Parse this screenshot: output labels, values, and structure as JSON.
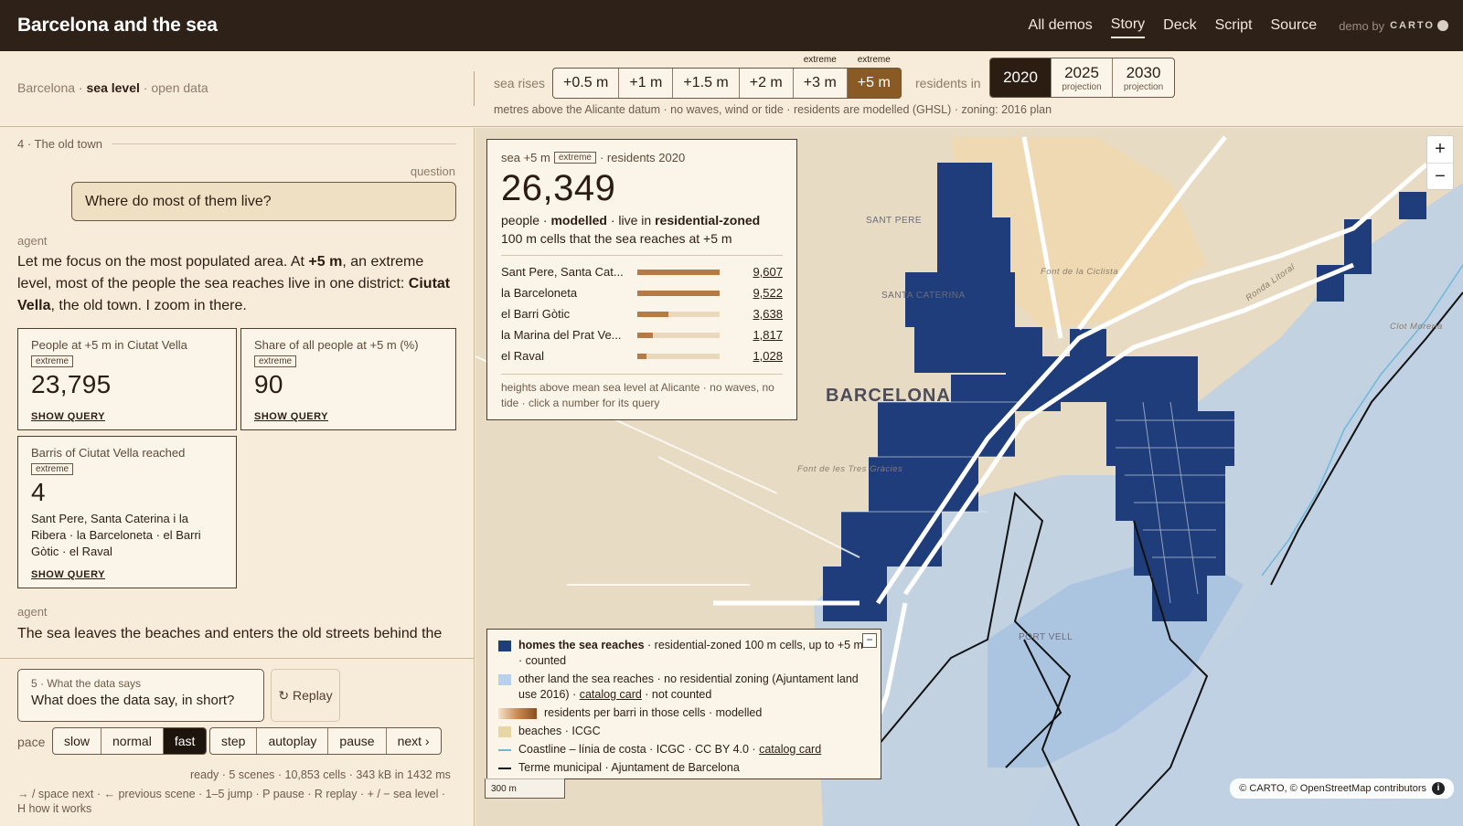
{
  "app": {
    "title": "Barcelona and the sea",
    "nav": [
      "All demos",
      "Story",
      "Deck",
      "Script",
      "Source"
    ],
    "nav_active": "Story",
    "demo_by": "demo by",
    "brand": "CARTO"
  },
  "breadcrumb": {
    "a": "Barcelona",
    "sep1": " · ",
    "b": "sea level",
    "sep2": " · ",
    "c": "open data"
  },
  "controls": {
    "sea_label": "sea rises",
    "sea_levels": [
      {
        "label": "+0.5 m",
        "tag": ""
      },
      {
        "label": "+1 m",
        "tag": ""
      },
      {
        "label": "+1.5 m",
        "tag": ""
      },
      {
        "label": "+2 m",
        "tag": ""
      },
      {
        "label": "+3 m",
        "tag": "extreme"
      },
      {
        "label": "+5 m",
        "tag": "extreme"
      }
    ],
    "sea_active": "+5 m",
    "residents_label": "residents in",
    "years": [
      {
        "year": "2020",
        "sub": ""
      },
      {
        "year": "2025",
        "sub": "projection"
      },
      {
        "year": "2030",
        "sub": "projection"
      }
    ],
    "year_active": "2020",
    "note": "metres above the Alicante datum · no waves, wind or tide · residents are modelled (GHSL) · zoning: 2016 plan"
  },
  "story": {
    "scene_head": "4 · The old town",
    "question_label": "question",
    "question": "Where do most of them live?",
    "agent_label": "agent",
    "agent_text_1": "Let me focus on the most populated area. At ",
    "agent_text_bold1": "+5 m",
    "agent_text_2": ", an extreme level, most of the people the sea reaches live in one district: ",
    "agent_text_bold2": "Ciutat Vella",
    "agent_text_3": ", the old town. I zoom in there.",
    "cards": [
      {
        "title": "People at +5 m in Ciutat Vella",
        "badge": "extreme",
        "value": "23,795",
        "detail": "",
        "link": "SHOW QUERY"
      },
      {
        "title": "Share of all people at +5 m (%)",
        "badge": "extreme",
        "value": "90",
        "detail": "",
        "link": "SHOW QUERY"
      },
      {
        "title": "Barris of Ciutat Vella reached",
        "badge": "extreme",
        "value": "4",
        "detail": "Sant Pere, Santa Caterina i la Ribera · la Barceloneta · el Barri Gòtic · el Raval",
        "link": "SHOW QUERY"
      }
    ],
    "agent_label_2": "agent",
    "agent_text_4": "The sea leaves the beaches and enters the old streets behind the"
  },
  "player": {
    "next_label": "5 · What the data says",
    "next_question": "What does the data say, in short?",
    "replay": "↻ Replay",
    "pace_label": "pace",
    "paces": [
      "slow",
      "normal",
      "fast"
    ],
    "pace_active": "fast",
    "steps": [
      "step",
      "autoplay",
      "pause",
      "next ›"
    ],
    "status": "ready · 5 scenes · 10,853 cells · 343 kB in 1432 ms",
    "keys": "→ / space next · ← previous scene · 1–5 jump · P pause · R replay · + / − sea level · H how it works"
  },
  "info": {
    "hdr_a": "sea +5 m",
    "hdr_badge": "extreme",
    "hdr_b": "· residents 2020",
    "total": "26,349",
    "desc_1": "people · ",
    "desc_b1": "modelled",
    "desc_2": " · live in ",
    "desc_b2": "residential-zoned",
    "desc_3": "100 m cells that the sea reaches at +5 m",
    "rows": [
      {
        "name": "Sant Pere, Santa Cat...",
        "value": "9,607",
        "n": 9607
      },
      {
        "name": "la Barceloneta",
        "value": "9,522",
        "n": 9522
      },
      {
        "name": "el Barri Gòtic",
        "value": "3,638",
        "n": 3638
      },
      {
        "name": "la Marina del Prat Ve...",
        "value": "1,817",
        "n": 1817
      },
      {
        "name": "el Raval",
        "value": "1,028",
        "n": 1028
      }
    ],
    "foot": "heights above mean sea level at Alicante · no waves, no tide · click a number for its query"
  },
  "legend": {
    "rows": [
      {
        "bold": "homes the sea reaches",
        "text": " · residential-zoned 100 m cells, up to +5 m · counted",
        "link": "",
        "after": "",
        "color": "#1e3d7a"
      },
      {
        "bold": "",
        "text": "other land the sea reaches · no residential zoning (Ajuntament land use 2016) · ",
        "link": "catalog card",
        "after": " · not counted",
        "color": "#b8d0ec"
      },
      {
        "bold": "",
        "text": "residents per barri in those cells · modelled",
        "link": "",
        "after": "",
        "color": "#c98a52"
      },
      {
        "bold": "",
        "text": "beaches · ICGC",
        "link": "",
        "after": "",
        "color": "#e8d6a4"
      },
      {
        "bold": "",
        "text": "Coastline – línia de costa · ICGC · CC BY 4.0 · ",
        "link": "catalog card",
        "after": "",
        "color": "#6fb8d8"
      },
      {
        "bold": "",
        "text": "Terme municipal · Ajuntament de Barcelona",
        "link": "",
        "after": "",
        "color": "#111111"
      }
    ],
    "collapse": "−"
  },
  "map": {
    "scale": "300 m",
    "attribution": "© CARTO, © OpenStreetMap contributors",
    "info_icon": "i",
    "zoom_in": "+",
    "zoom_out": "−",
    "labels": {
      "city": "BARCELONA",
      "sant_pere": "SANT PERE",
      "santa_caterina": "SANTA CATERINA",
      "port_vell": "PORT VELL",
      "font_ciclista": "Font de la Ciclista",
      "font_tres_gracies": "Font de les Tres Gràcies",
      "ronda_litoral": "Ronda Litoral",
      "clot_moreria": "Clot Moreria"
    }
  }
}
